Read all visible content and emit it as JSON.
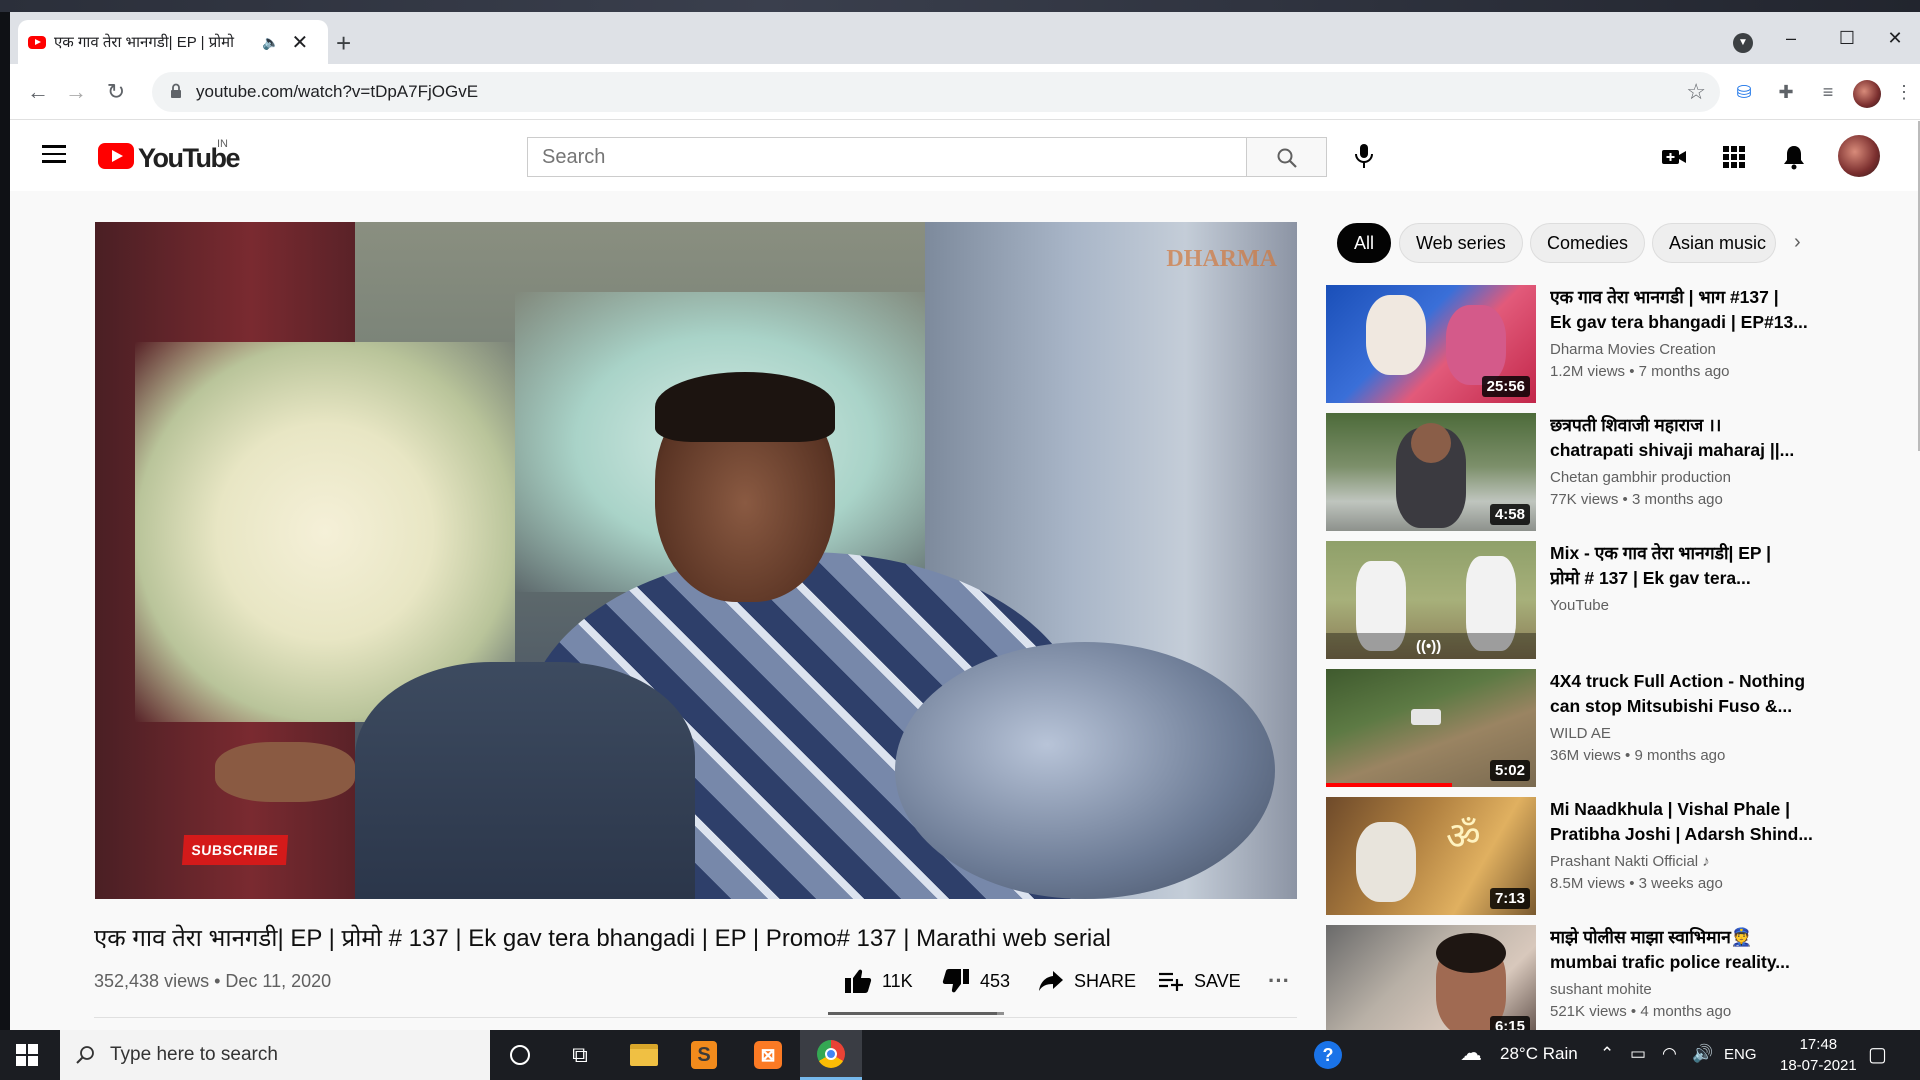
{
  "browser": {
    "tab_title": "एक गाव तेरा भानगडी| EP | प्रोमो",
    "url": "youtube.com/watch?v=tDpA7FjOGvE",
    "new_tab_label": "+",
    "window_controls": [
      "–",
      "☐",
      "✕"
    ]
  },
  "youtube": {
    "logo_text": "YouTube",
    "country_code": "IN",
    "search_placeholder": "Search",
    "brand_color": "#FF0000"
  },
  "video": {
    "subscribe_overlay": "SUBSCRIBE",
    "watermark": "DHARMA",
    "title": "एक गाव तेरा भानगडी| EP | प्रोमो # 137 | Ek gav tera bhangadi | EP | Promo# 137 | Marathi web serial",
    "views": "352,438 views",
    "date": "Dec 11, 2020",
    "likes": "11K",
    "dislikes": "453",
    "share_label": "SHARE",
    "save_label": "SAVE",
    "like_ratio": 0.96
  },
  "chips": [
    "All",
    "Web series",
    "Comedies",
    "Asian music"
  ],
  "recommendations": [
    {
      "title_line1": "एक गाव तेरा भानगडी | भाग #137 |",
      "title_line2": "Ek gav tera bhangadi | EP#13...",
      "channel": "Dharma Movies Creation",
      "views": "1.2M views",
      "age": "7 months ago",
      "duration": "25:56",
      "watched": 0
    },
    {
      "title_line1": "छत्रपती शिवाजी महाराज ।।",
      "title_line2": "chatrapati shivaji maharaj ||...",
      "channel": "Chetan gambhir production",
      "views": "77K views",
      "age": "3 months ago",
      "duration": "4:58",
      "watched": 0
    },
    {
      "title_line1": "Mix - एक गाव तेरा भानगडी| EP |",
      "title_line2": "प्रोमो # 137 | Ek gav tera...",
      "channel": "YouTube",
      "views": "",
      "age": "",
      "duration": "",
      "watched": 0
    },
    {
      "title_line1": "4X4 truck Full Action - Nothing",
      "title_line2": "can stop Mitsubishi Fuso &...",
      "channel": "WILD AE",
      "views": "36M views",
      "age": "9 months ago",
      "duration": "5:02",
      "watched": 0.6
    },
    {
      "title_line1": "Mi Naadkhula | Vishal Phale |",
      "title_line2": "Pratibha Joshi | Adarsh Shind...",
      "channel": "Prashant Nakti Official",
      "views": "8.5M views",
      "age": "3 weeks ago",
      "duration": "7:13",
      "watched": 0
    },
    {
      "title_line1": "माझे पोलीस माझा स्वाभिमान👮",
      "title_line2": "mumbai trafic police reality...",
      "channel": "sushant mohite",
      "views": "521K views",
      "age": "4 months ago",
      "duration": "6:15",
      "watched": 0
    }
  ],
  "taskbar": {
    "search_placeholder": "Type here to search",
    "weather": "28°C  Rain",
    "language": "ENG",
    "time": "17:48",
    "date": "18-07-2021"
  }
}
